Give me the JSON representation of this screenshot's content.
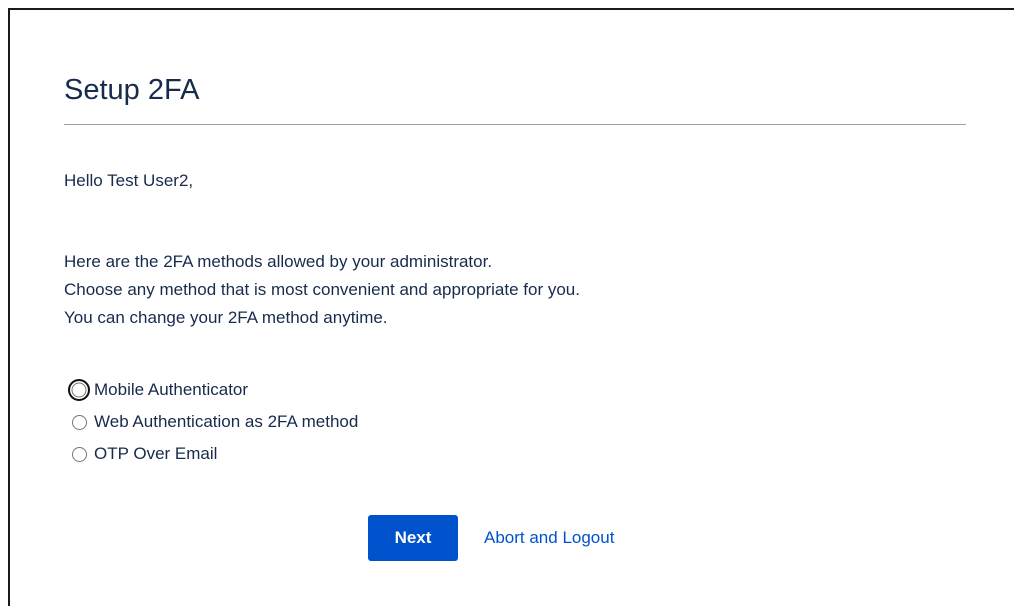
{
  "page": {
    "title": "Setup 2FA",
    "greeting": "Hello Test User2,",
    "intro_lines": [
      "Here are the 2FA methods allowed by your administrator.",
      "Choose any method that is most convenient and appropriate for you.",
      "You can change your 2FA method anytime."
    ]
  },
  "methods": [
    {
      "label": "Mobile Authenticator",
      "checked": false,
      "focused": true
    },
    {
      "label": "Web Authentication as 2FA method",
      "checked": false,
      "focused": false
    },
    {
      "label": "OTP Over Email",
      "checked": false,
      "focused": false
    }
  ],
  "actions": {
    "next_label": "Next",
    "abort_label": "Abort and Logout"
  },
  "colors": {
    "primary": "#0052cc",
    "text": "#172b4d",
    "divider": "#a0a0a0"
  }
}
